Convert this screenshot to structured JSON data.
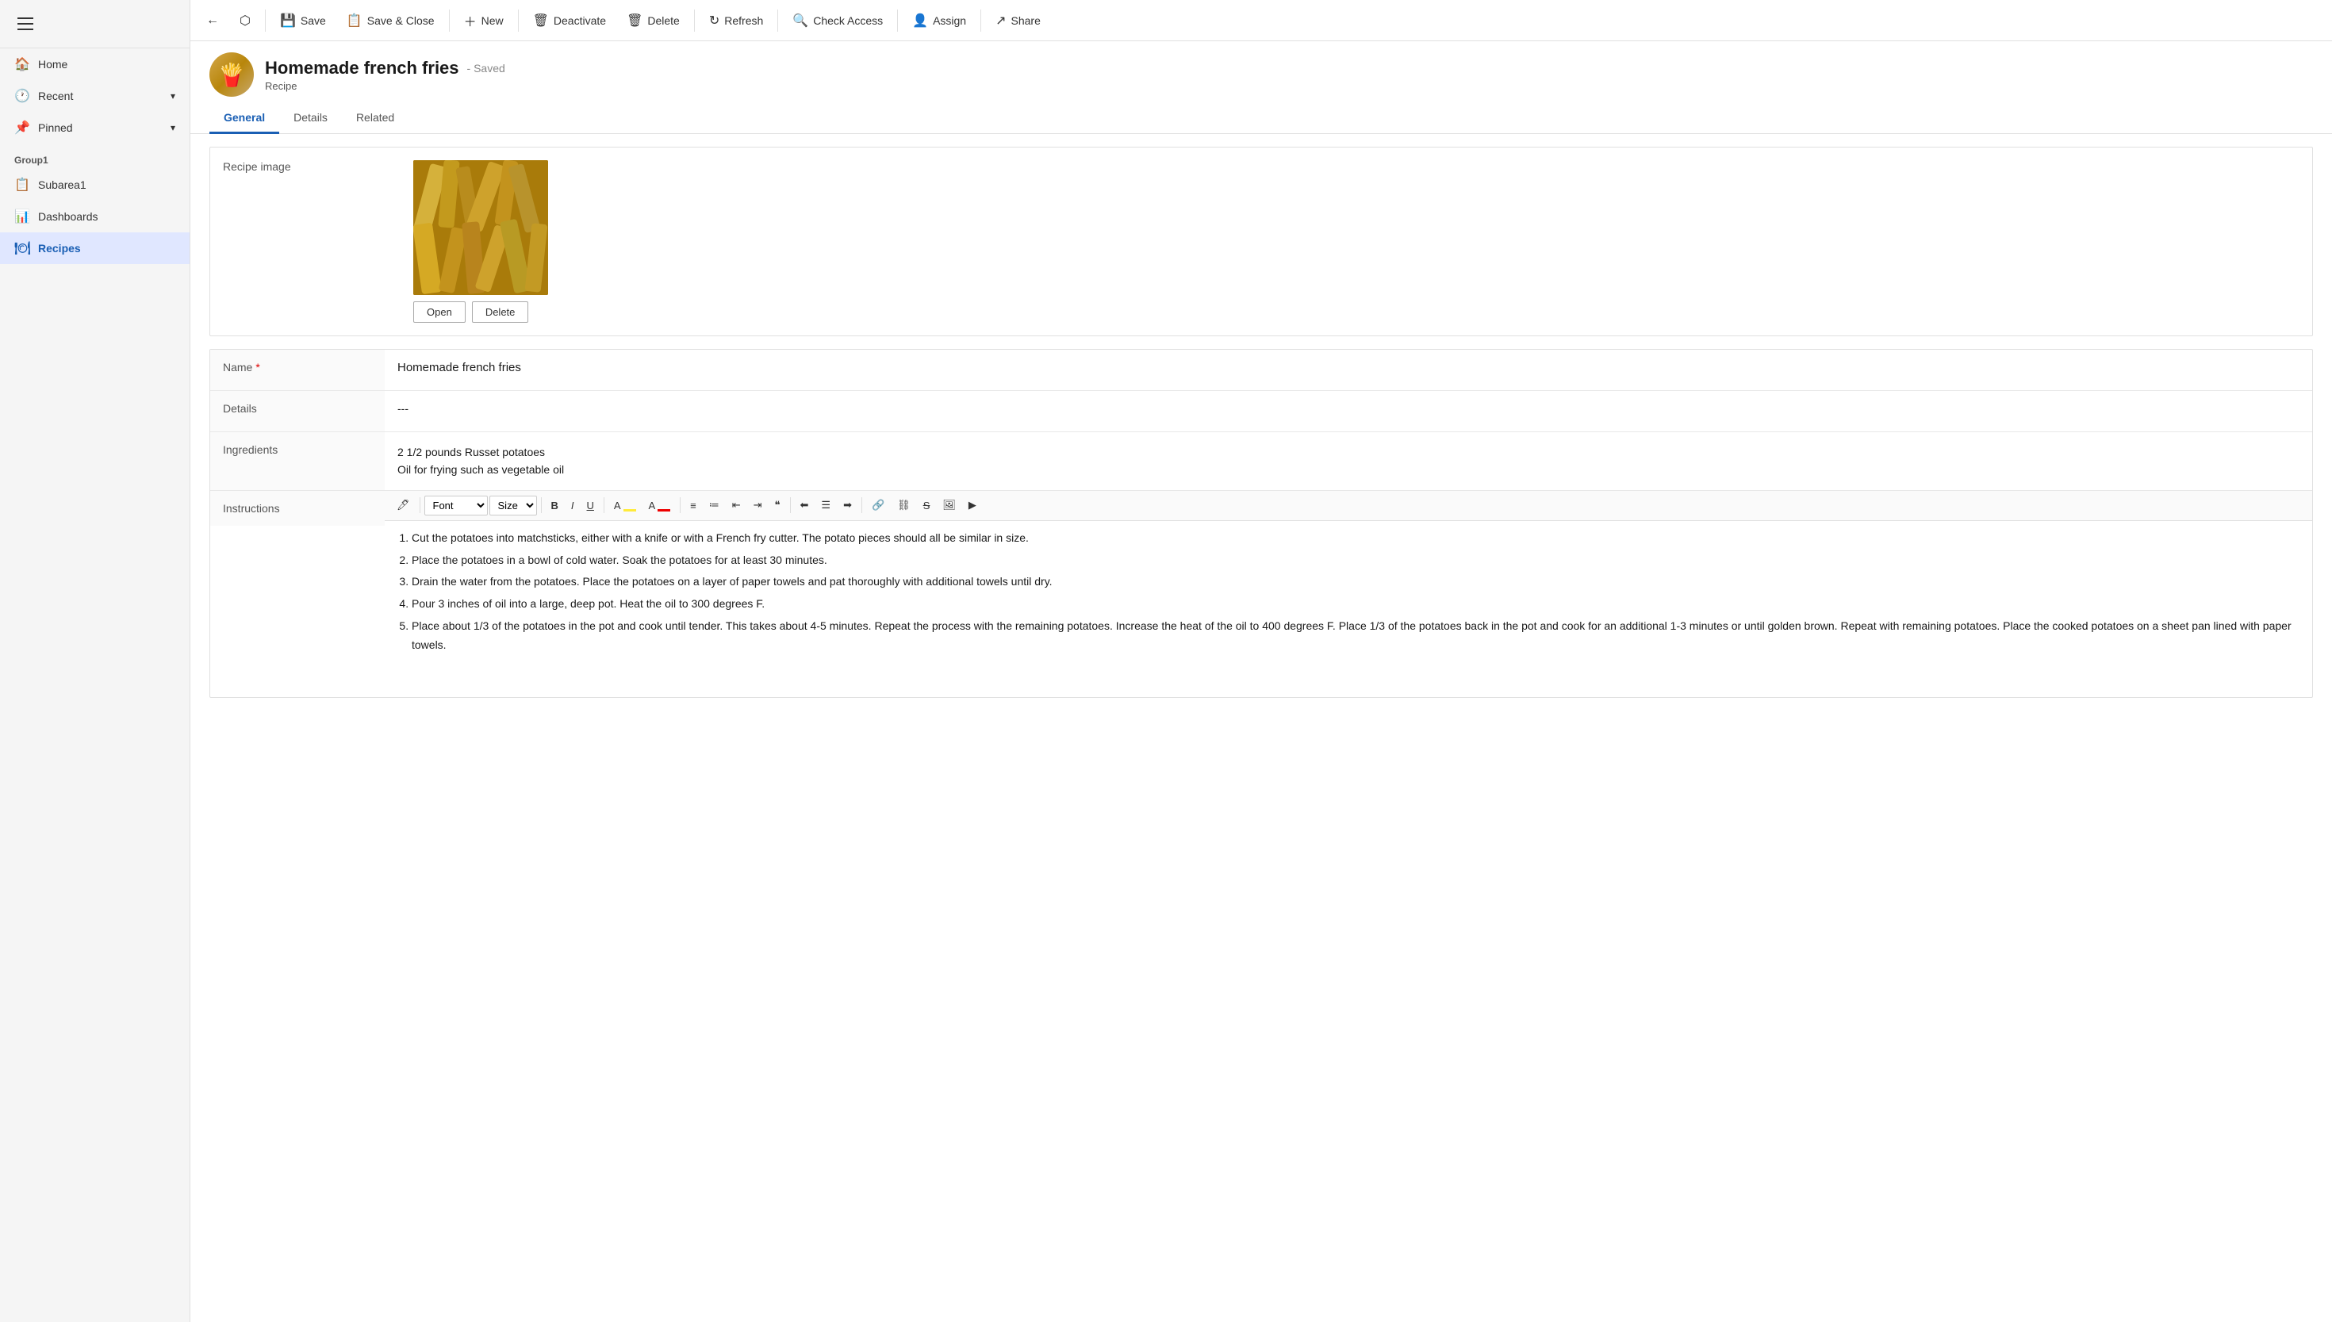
{
  "sidebar": {
    "hamburger_label": "Menu",
    "items": [
      {
        "id": "home",
        "label": "Home",
        "icon": "🏠",
        "active": false
      },
      {
        "id": "recent",
        "label": "Recent",
        "icon": "🕐",
        "has_chevron": true,
        "active": false
      },
      {
        "id": "pinned",
        "label": "Pinned",
        "icon": "📌",
        "has_chevron": true,
        "active": false
      }
    ],
    "group_label": "Group1",
    "sub_items": [
      {
        "id": "subarea1",
        "label": "Subarea1",
        "icon": "📋",
        "active": false
      },
      {
        "id": "dashboards",
        "label": "Dashboards",
        "icon": "📊",
        "active": false
      },
      {
        "id": "recipes",
        "label": "Recipes",
        "icon": "🍽",
        "active": true
      }
    ]
  },
  "toolbar": {
    "back_label": "",
    "open_label": "",
    "save_label": "Save",
    "save_close_label": "Save & Close",
    "new_label": "New",
    "deactivate_label": "Deactivate",
    "delete_label": "Delete",
    "refresh_label": "Refresh",
    "check_access_label": "Check Access",
    "assign_label": "Assign",
    "share_label": "Share"
  },
  "record": {
    "title": "Homemade french fries",
    "saved_status": "- Saved",
    "type": "Recipe"
  },
  "tabs": [
    {
      "id": "general",
      "label": "General",
      "active": true
    },
    {
      "id": "details",
      "label": "Details",
      "active": false
    },
    {
      "id": "related",
      "label": "Related",
      "active": false
    }
  ],
  "form": {
    "image_label": "Recipe image",
    "open_button": "Open",
    "delete_button": "Delete",
    "name_label": "Name",
    "name_required": true,
    "name_value": "Homemade french fries",
    "details_label": "Details",
    "details_value": "---",
    "ingredients_label": "Ingredients",
    "ingredients_lines": [
      "2 1/2 pounds Russet potatoes",
      "Oil for frying such as vegetable oil"
    ],
    "instructions_label": "Instructions",
    "rich_toolbar": {
      "font_label": "Font",
      "size_label": "Size",
      "bold": "B",
      "italic": "I",
      "underline": "U"
    },
    "instructions": [
      "Cut the potatoes into matchsticks, either with a knife or with a French fry cutter. The potato pieces should all be similar in size.",
      "Place the potatoes in a bowl of cold water. Soak the potatoes for at least 30 minutes.",
      "Drain the water from the potatoes. Place the potatoes on a layer of paper towels and pat thoroughly with additional towels until dry.",
      "Pour 3 inches of oil into a large, deep pot. Heat the oil to 300 degrees F.",
      "Place about 1/3 of the potatoes in the pot and cook until tender. This takes about 4-5 minutes. Repeat the process with the remaining potatoes. Increase the heat of the oil to 400 degrees F. Place 1/3 of the potatoes back in the pot and cook for an additional 1-3 minutes or until golden brown. Repeat with remaining potatoes. Place the cooked potatoes on a sheet pan lined with paper towels."
    ]
  },
  "colors": {
    "active_tab": "#1a5fb4",
    "active_nav": "#e0e7ff",
    "required_star": "#cc0000"
  }
}
